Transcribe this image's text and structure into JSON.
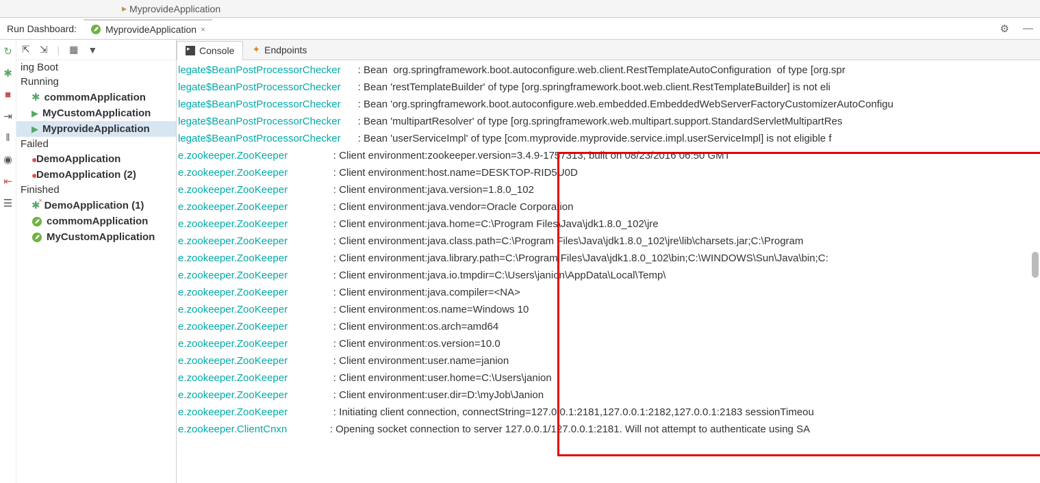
{
  "editor_tab": {
    "label": "MyprovideApplication"
  },
  "dashboard": {
    "label": "Run Dashboard:",
    "run_tab": "MyprovideApplication"
  },
  "tree": {
    "root": "ing Boot",
    "sections": {
      "running": "Running",
      "failed": "Failed",
      "finished": "Finished"
    },
    "running": [
      {
        "name": "commomApplication",
        "iconType": "bug-green",
        "bold": true
      },
      {
        "name": "MyCustomApplication",
        "iconType": "play-green",
        "bold": true
      },
      {
        "name": "MyprovideApplication",
        "iconType": "play-green",
        "bold": true,
        "selected": true
      }
    ],
    "failed": [
      {
        "name": "DemoApplication",
        "iconType": "error-red",
        "bold": true
      },
      {
        "name": "DemoApplication (2)",
        "iconType": "error-red",
        "bold": true
      }
    ],
    "finished": [
      {
        "name": "DemoApplication (1)",
        "iconType": "bug-redx",
        "bold": true
      },
      {
        "name": "commomApplication",
        "iconType": "leaf",
        "bold": true
      },
      {
        "name": "MyCustomApplication",
        "iconType": "leaf",
        "bold": true
      }
    ]
  },
  "console_tabs": {
    "console": "Console",
    "endpoints": "Endpoints"
  },
  "log": [
    {
      "logger": "legate$BeanPostProcessorChecker",
      "msg": "Bean  org.springframework.boot.autoconfigure.web.client.RestTemplateAutoConfiguration  of type [org.spr"
    },
    {
      "logger": "legate$BeanPostProcessorChecker",
      "msg": "Bean 'restTemplateBuilder' of type [org.springframework.boot.web.client.RestTemplateBuilder] is not eli"
    },
    {
      "logger": "legate$BeanPostProcessorChecker",
      "msg": "Bean 'org.springframework.boot.autoconfigure.web.embedded.EmbeddedWebServerFactoryCustomizerAutoConfigu"
    },
    {
      "logger": "legate$BeanPostProcessorChecker",
      "msg": "Bean 'multipartResolver' of type [org.springframework.web.multipart.support.StandardServletMultipartRes"
    },
    {
      "logger": "legate$BeanPostProcessorChecker",
      "msg": "Bean 'userServiceImpl' of type [com.myprovide.myprovide.service.impl.userServiceImpl] is not eligible f"
    },
    {
      "logger": "e.zookeeper.ZooKeeper",
      "msg": "Client environment:zookeeper.version=3.4.9-1757313, built on 08/23/2016 06:50 GMT"
    },
    {
      "logger": "e.zookeeper.ZooKeeper",
      "msg": "Client environment:host.name=DESKTOP-RID5U0D"
    },
    {
      "logger": "e.zookeeper.ZooKeeper",
      "msg": "Client environment:java.version=1.8.0_102"
    },
    {
      "logger": "e.zookeeper.ZooKeeper",
      "msg": "Client environment:java.vendor=Oracle Corporation"
    },
    {
      "logger": "e.zookeeper.ZooKeeper",
      "msg": "Client environment:java.home=C:\\Program Files\\Java\\jdk1.8.0_102\\jre"
    },
    {
      "logger": "e.zookeeper.ZooKeeper",
      "msg": "Client environment:java.class.path=C:\\Program Files\\Java\\jdk1.8.0_102\\jre\\lib\\charsets.jar;C:\\Program "
    },
    {
      "logger": "e.zookeeper.ZooKeeper",
      "msg": "Client environment:java.library.path=C:\\Program Files\\Java\\jdk1.8.0_102\\bin;C:\\WINDOWS\\Sun\\Java\\bin;C:"
    },
    {
      "logger": "e.zookeeper.ZooKeeper",
      "msg": "Client environment:java.io.tmpdir=C:\\Users\\janion\\AppData\\Local\\Temp\\"
    },
    {
      "logger": "e.zookeeper.ZooKeeper",
      "msg": "Client environment:java.compiler=<NA>"
    },
    {
      "logger": "e.zookeeper.ZooKeeper",
      "msg": "Client environment:os.name=Windows 10"
    },
    {
      "logger": "e.zookeeper.ZooKeeper",
      "msg": "Client environment:os.arch=amd64"
    },
    {
      "logger": "e.zookeeper.ZooKeeper",
      "msg": "Client environment:os.version=10.0"
    },
    {
      "logger": "e.zookeeper.ZooKeeper",
      "msg": "Client environment:user.name=janion"
    },
    {
      "logger": "e.zookeeper.ZooKeeper",
      "msg": "Client environment:user.home=C:\\Users\\janion"
    },
    {
      "logger": "e.zookeeper.ZooKeeper",
      "msg": "Client environment:user.dir=D:\\myJob\\Janion"
    },
    {
      "logger": "e.zookeeper.ZooKeeper",
      "msg": "Initiating client connection, connectString=127.0.0.1:2181,127.0.0.1:2182,127.0.0.1:2183 sessionTimeou"
    },
    {
      "logger": "e.zookeeper.ClientCnxn",
      "msg": "Opening socket connection to server 127.0.0.1/127.0.0.1:2181. Will not attempt to authenticate using SA"
    }
  ]
}
